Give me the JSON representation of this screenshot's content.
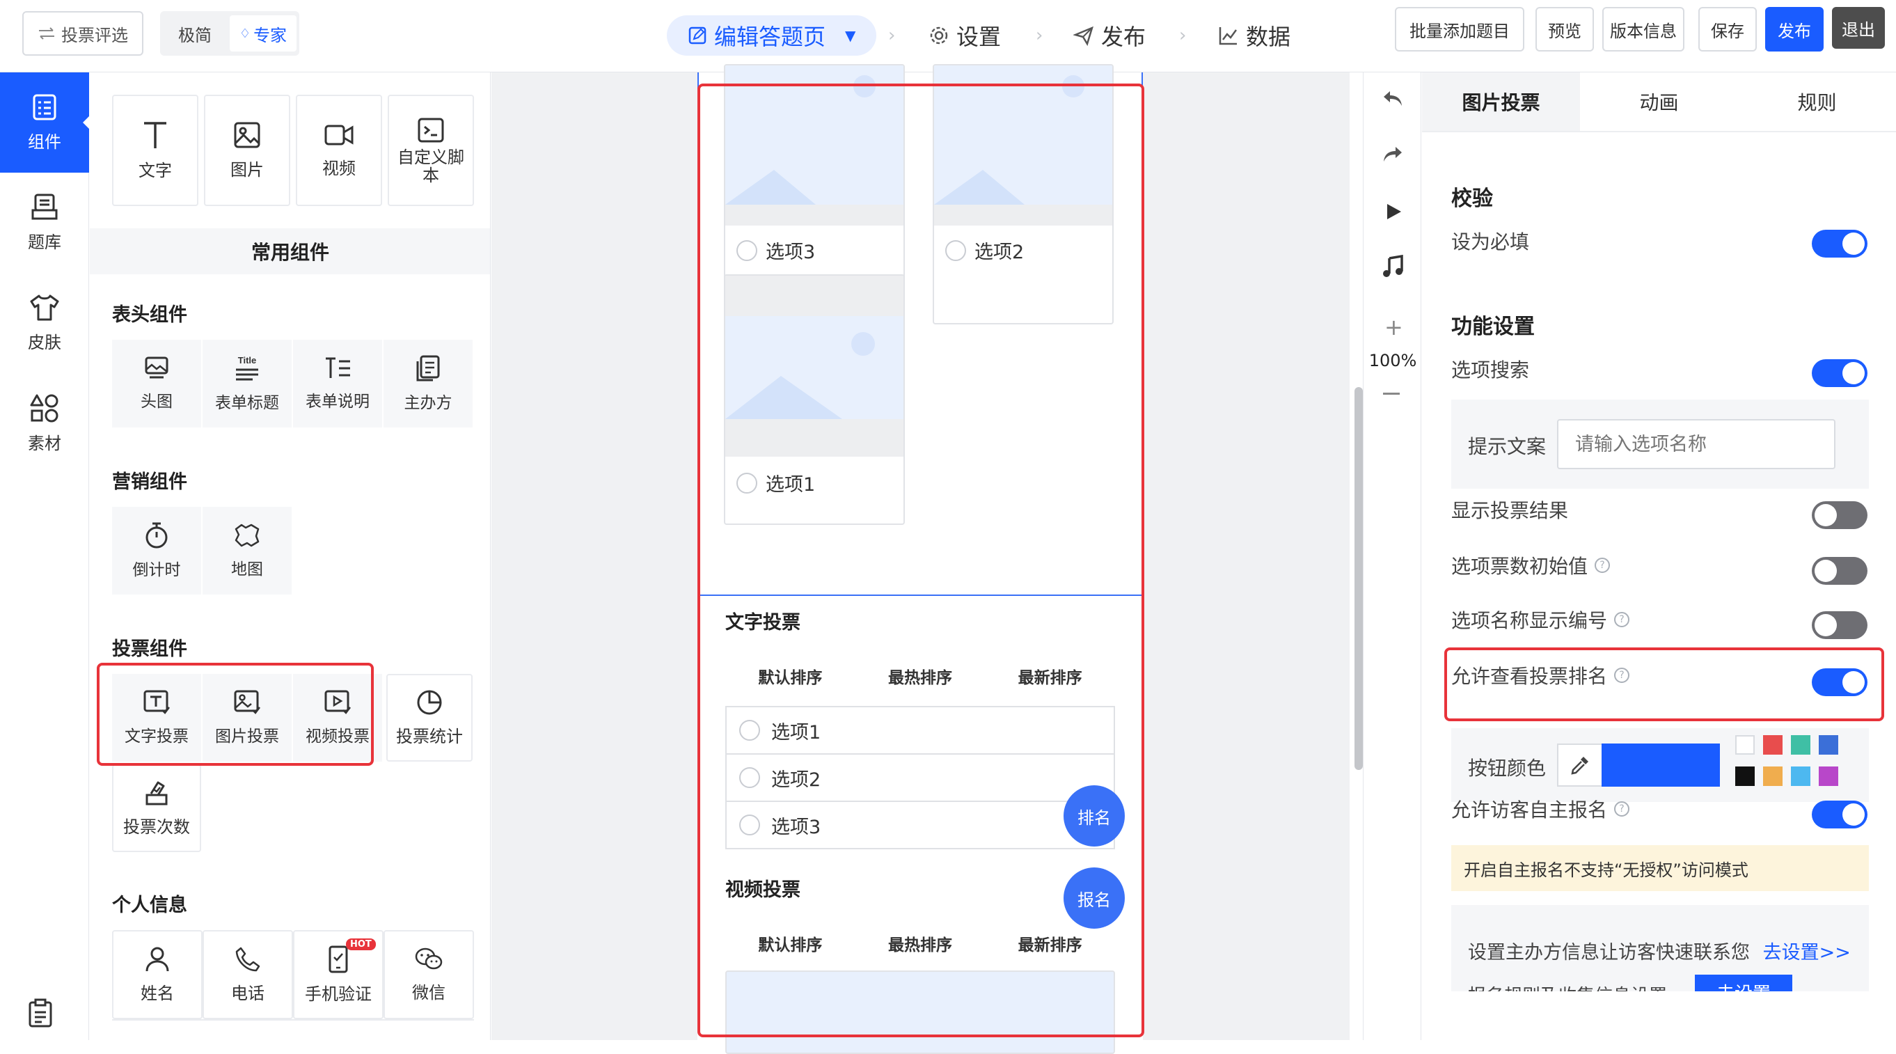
{
  "topbar": {
    "back_label": "投票评选",
    "mode_simple": "极简",
    "mode_expert": "专家",
    "steps": [
      {
        "label": "编辑答题页",
        "icon": "edit-icon"
      },
      {
        "label": "设置",
        "icon": "gear-icon"
      },
      {
        "label": "发布",
        "icon": "send-icon"
      },
      {
        "label": "数据",
        "icon": "chart-icon"
      }
    ],
    "actions": {
      "batch_add": "批量添加题目",
      "preview": "预览",
      "version": "版本信息",
      "save": "保存",
      "publish": "发布",
      "exit": "退出"
    }
  },
  "leftnav": {
    "items": [
      {
        "label": "组件",
        "icon": "form-list-icon",
        "active": true
      },
      {
        "label": "题库",
        "icon": "question-bank-icon"
      },
      {
        "label": "皮肤",
        "icon": "shirt-icon"
      },
      {
        "label": "素材",
        "icon": "shapes-icon"
      }
    ]
  },
  "components": {
    "basic": [
      {
        "label": "文字",
        "icon": "text-icon"
      },
      {
        "label": "图片",
        "icon": "image-icon"
      },
      {
        "label": "视频",
        "icon": "video-icon"
      },
      {
        "label": "自定义脚本",
        "icon": "script-icon"
      }
    ],
    "common_title": "常用组件",
    "header_title": "表头组件",
    "header": [
      {
        "label": "头图",
        "icon": "header-image-icon"
      },
      {
        "label": "表单标题",
        "icon": "title-icon"
      },
      {
        "label": "表单说明",
        "icon": "description-icon"
      },
      {
        "label": "主办方",
        "icon": "organizer-icon"
      }
    ],
    "marketing_title": "营销组件",
    "marketing": [
      {
        "label": "倒计时",
        "icon": "stopwatch-icon"
      },
      {
        "label": "地图",
        "icon": "map-icon"
      }
    ],
    "vote_title": "投票组件",
    "vote": [
      {
        "label": "文字投票",
        "icon": "text-vote-icon"
      },
      {
        "label": "图片投票",
        "icon": "image-vote-icon"
      },
      {
        "label": "视频投票",
        "icon": "video-vote-icon"
      },
      {
        "label": "投票统计",
        "icon": "pie-chart-icon"
      },
      {
        "label": "投票次数",
        "icon": "vote-count-icon"
      }
    ],
    "personal_title": "个人信息",
    "personal": [
      {
        "label": "姓名",
        "icon": "user-icon"
      },
      {
        "label": "电话",
        "icon": "phone-icon"
      },
      {
        "label": "手机验证",
        "icon": "phone-verify-icon",
        "badge": "HOT"
      },
      {
        "label": "微信",
        "icon": "wechat-icon"
      }
    ]
  },
  "canvas": {
    "image_options": [
      "选项3",
      "选项2",
      "选项1"
    ],
    "text_vote": {
      "title": "文字投票",
      "sorts": [
        "默认排序",
        "最热排序",
        "最新排序"
      ],
      "options": [
        "选项1",
        "选项2",
        "选项3"
      ]
    },
    "video_vote": {
      "title": "视频投票",
      "sorts": [
        "默认排序",
        "最热排序",
        "最新排序"
      ]
    },
    "float_rank": "排名",
    "float_signup": "报名"
  },
  "tools": {
    "zoom": "100%",
    "icons": [
      "undo-icon",
      "redo-icon",
      "play-icon",
      "music-icon",
      "zoom-in-icon",
      "zoom-out-icon"
    ]
  },
  "settings": {
    "tabs": [
      "图片投票",
      "动画",
      "规则"
    ],
    "validation_title": "校验",
    "required": {
      "label": "设为必填",
      "on": true
    },
    "feature_title": "功能设置",
    "option_search": {
      "label": "选项搜索",
      "on": true
    },
    "hint_label": "提示文案",
    "hint_placeholder": "请输入选项名称",
    "show_result": {
      "label": "显示投票结果",
      "on": false
    },
    "initial_votes": {
      "label": "选项票数初始值",
      "on": false
    },
    "show_number": {
      "label": "选项名称显示编号",
      "on": false
    },
    "allow_rank": {
      "label": "允许查看投票排名",
      "on": true
    },
    "button_color_label": "按钮颜色",
    "button_color": "#1a5cff",
    "swatches": [
      "#ffffff",
      "#e84d4d",
      "#3fbfa5",
      "#3b6fd8",
      "#111111",
      "#f0ad4e",
      "#4db8f0",
      "#b847c9"
    ],
    "allow_signup": {
      "label": "允许访客自主报名",
      "on": true
    },
    "notice": "开启自主报名不支持“无授权”访问模式",
    "organizer_text": "设置主办方信息让访客快速联系您",
    "organizer_link": "去设置>>",
    "rules_text": "报名规则及收集信息设置",
    "rules_button": "去设置"
  }
}
